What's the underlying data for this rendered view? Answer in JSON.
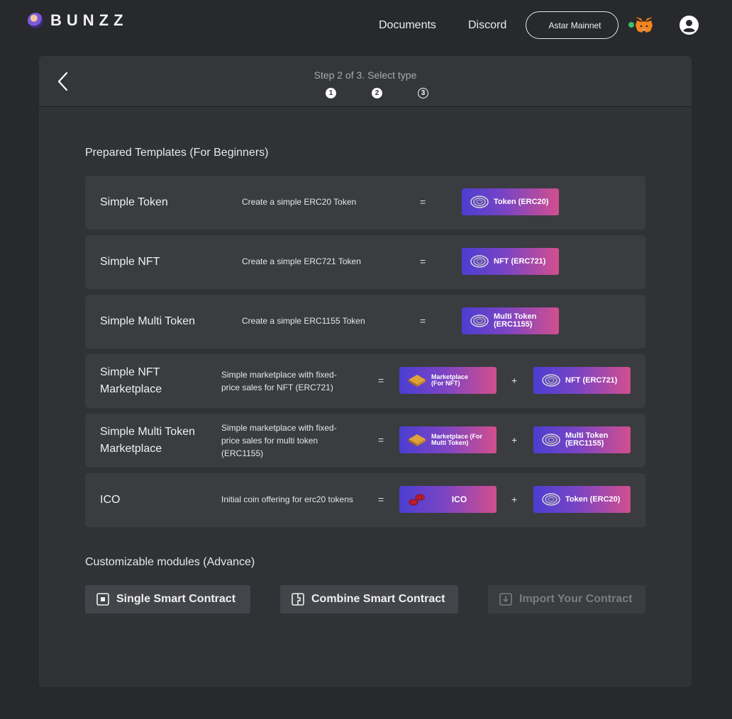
{
  "header": {
    "logo_text": "BUNZZ",
    "nav": [
      "Documents",
      "Discord"
    ],
    "network": "Astar Mainnet"
  },
  "stepper": {
    "text": "Step 2 of 3. Select type",
    "steps": [
      "1",
      "2",
      "3"
    ]
  },
  "templates": {
    "title": "Prepared Templates (For Beginners)",
    "rows": [
      {
        "name": "Simple Token",
        "desc": "Create a simple ERC20 Token",
        "chips": [
          "Token (ERC20)"
        ]
      },
      {
        "name": "Simple NFT",
        "desc": "Create a simple ERC721 Token",
        "chips": [
          "NFT (ERC721)"
        ]
      },
      {
        "name": "Simple Multi Token",
        "desc": "Create a simple ERC1155 Token",
        "chips": [
          "Multi Token (ERC1155)"
        ]
      },
      {
        "name": "Simple NFT Marketplace",
        "desc": "Simple marketplace with fixed-price sales for NFT (ERC721)",
        "chips": [
          "Marketplace (For NFT)",
          "NFT (ERC721)"
        ]
      },
      {
        "name": "Simple Multi Token Marketplace",
        "desc": "Simple marketplace with fixed-price sales for multi token (ERC1155)",
        "chips": [
          "Marketplace (For Multi Token)",
          "Multi Token (ERC1155)"
        ]
      },
      {
        "name": "ICO",
        "desc": "Initial coin offering for erc20 tokens",
        "chips": [
          "ICO",
          "Token (ERC20)"
        ]
      }
    ],
    "equals": "=",
    "plus": "+"
  },
  "modules": {
    "title": "Customizable modules (Advance)",
    "buttons": [
      "Single Smart Contract",
      "Combine Smart Contract",
      "Import Your Contract"
    ]
  },
  "colors": {
    "background": "#27292d",
    "panel": "#303236",
    "chip_gradient_start": "#4b3ed1",
    "chip_gradient_end": "#d24f8e",
    "status": "#3bbf6b"
  }
}
